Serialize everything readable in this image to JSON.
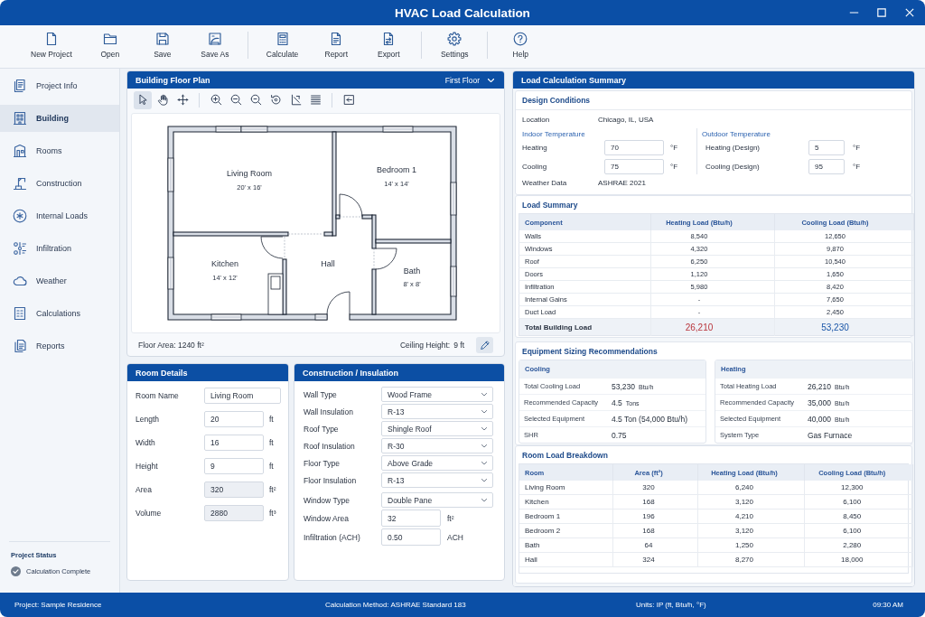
{
  "window": {
    "title": "HVAC Load Calculation"
  },
  "toolbar": [
    "New Project",
    "Open",
    "Save",
    "Save As",
    "Calculate",
    "Report",
    "Export",
    "Settings",
    "Help"
  ],
  "sidebar": {
    "items": [
      {
        "label": "Project Info",
        "selected": false
      },
      {
        "label": "Building",
        "selected": true
      },
      {
        "label": "Rooms",
        "selected": false
      },
      {
        "label": "Construction",
        "selected": false
      },
      {
        "label": "Internal Loads",
        "selected": false
      },
      {
        "label": "Infiltration",
        "selected": false
      },
      {
        "label": "Weather",
        "selected": false
      },
      {
        "label": "Calculations",
        "selected": false
      },
      {
        "label": "Reports",
        "selected": false
      }
    ],
    "project_status": {
      "title": "Project Status",
      "message": "Calculation Complete"
    }
  },
  "floor_plan": {
    "title": "Building Floor Plan",
    "floor": "First Floor",
    "tools": [
      {
        "selected": true
      },
      {
        "selected": false
      },
      {
        "selected": false
      },
      {
        "selected": false
      },
      {
        "selected": false
      },
      {
        "selected": false
      },
      {
        "selected": false
      },
      {
        "selected": false
      },
      {
        "selected": false
      },
      {
        "selected": false
      }
    ],
    "rooms": [
      {
        "name": "Living Room",
        "dimensions": "20' x 16'"
      },
      {
        "name": "Bedroom 1",
        "dimensions": "14' x 14'"
      },
      {
        "name": "Kitchen",
        "dimensions": "14' x 12'"
      },
      {
        "name": "Hall"
      },
      {
        "name": "Bath",
        "dimensions": "8' x 8'"
      }
    ],
    "floor_area": "Floor Area: 1240 ft²",
    "ceiling_height": {
      "label": "Ceiling Height:",
      "value": "9 ft"
    }
  },
  "room_details": {
    "title": "Room Details",
    "fields": [
      {
        "label": "Room Name",
        "value": "Living Room",
        "disabled": false
      },
      {
        "label": "Length",
        "value": "20",
        "unit": "ft",
        "disabled": false
      },
      {
        "label": "Width",
        "value": "16",
        "unit": "ft",
        "disabled": false
      },
      {
        "label": "Height",
        "value": "9",
        "unit": "ft",
        "disabled": false
      },
      {
        "label": "Area",
        "value": "320",
        "unit": "ft²",
        "disabled": true
      },
      {
        "label": "Volume",
        "value": "2880",
        "unit": "ft³",
        "disabled": true
      }
    ]
  },
  "construction": {
    "title": "Construction / Insulation",
    "groups": [
      {
        "fields": [
          {
            "kind": "select",
            "label": "Wall Type",
            "value": "Wood Frame"
          },
          {
            "kind": "select",
            "label": "Wall Insulation",
            "value": "R-13"
          },
          {
            "kind": "select",
            "label": "Roof Type",
            "value": "Shingle Roof"
          },
          {
            "kind": "select",
            "label": "Roof Insulation",
            "value": "R-30"
          },
          {
            "kind": "select",
            "label": "Floor Type",
            "value": "Above Grade"
          },
          {
            "kind": "select",
            "label": "Floor Insulation",
            "value": "R-13"
          }
        ]
      },
      {
        "fields": [
          {
            "kind": "select",
            "label": "Window Type",
            "value": "Double Pane"
          },
          {
            "kind": "input",
            "label": "Window Area",
            "value": "32",
            "unit": "ft²"
          },
          {
            "kind": "input",
            "label": "Infiltration (ACH)",
            "value": "0.50",
            "unit": "ACH"
          }
        ]
      }
    ]
  },
  "summary": {
    "title": "Load Calculation Summary",
    "design_conditions": {
      "title": "Design Conditions",
      "location": {
        "label": "Location",
        "value": "Chicago, IL, USA"
      },
      "indoor": {
        "title": "Indoor Temperature",
        "fields": [
          {
            "label": "Heating",
            "value": "70",
            "unit": "°F"
          },
          {
            "label": "Cooling",
            "value": "75",
            "unit": "°F"
          }
        ]
      },
      "outdoor": {
        "title": "Outdoor Temperature",
        "fields": [
          {
            "label": "Heating (Design)",
            "value": "5",
            "unit": "°F"
          },
          {
            "label": "Cooling (Design)",
            "value": "95",
            "unit": "°F"
          }
        ]
      },
      "weather_data": {
        "label": "Weather Data",
        "value": "ASHRAE 2021"
      }
    },
    "load_summary": {
      "title": "Load Summary",
      "columns": [
        "Component",
        "Heating Load (Btu/h)",
        "Cooling Load (Btu/h)"
      ],
      "rows": [
        [
          "Walls",
          "8,540",
          "12,650"
        ],
        [
          "Windows",
          "4,320",
          "9,870"
        ],
        [
          "Roof",
          "6,250",
          "10,540"
        ],
        [
          "Doors",
          "1,120",
          "1,650"
        ],
        [
          "Infiltration",
          "5,980",
          "8,420"
        ],
        [
          "Internal Gains",
          "-",
          "7,650"
        ],
        [
          "Duct Load",
          "-",
          "2,450"
        ]
      ],
      "total": [
        "Total Building Load",
        "26,210",
        "53,230"
      ]
    },
    "equipment": {
      "title": "Equipment Sizing Recommendations",
      "cards": [
        {
          "title": "Cooling",
          "rows": [
            {
              "label": "Total Cooling Load",
              "value": "53,230",
              "unit": "Btu/h"
            },
            {
              "label": "Recommended Capacity",
              "value": "4.5",
              "unit": "Tons"
            },
            {
              "label": "Selected Equipment",
              "value": "4.5 Ton (54,000 Btu/h)"
            },
            {
              "label": "SHR",
              "value": "0.75"
            }
          ]
        },
        {
          "title": "Heating",
          "rows": [
            {
              "label": "Total Heating Load",
              "value": "26,210",
              "unit": "Btu/h"
            },
            {
              "label": "Recommended Capacity",
              "value": "35,000",
              "unit": "Btu/h"
            },
            {
              "label": "Selected Equipment",
              "value": "40,000",
              "unit": "Btu/h"
            },
            {
              "label": "System Type",
              "value": "Gas Furnace"
            }
          ]
        }
      ]
    },
    "room_breakdown": {
      "title": "Room Load Breakdown",
      "columns": [
        "Room",
        "Area (ft²)",
        "Heating Load (Btu/h)",
        "Cooling Load (Btu/h)"
      ],
      "rows": [
        [
          "Living Room",
          "320",
          "6,240",
          "12,300"
        ],
        [
          "Kitchen",
          "168",
          "3,120",
          "6,100"
        ],
        [
          "Bedroom 1",
          "196",
          "4,210",
          "8,450"
        ],
        [
          "Bedroom 2",
          "168",
          "3,120",
          "6,100"
        ],
        [
          "Bath",
          "64",
          "1,250",
          "2,280"
        ],
        [
          "Hall",
          "324",
          "8,270",
          "18,000"
        ]
      ]
    }
  },
  "status_bar": {
    "project": "Project: Sample Residence",
    "method": "Calculation Method: ASHRAE Standard 183",
    "units": "Units: IP (ft, Btu/h, °F)",
    "time": "09:30 AM"
  }
}
